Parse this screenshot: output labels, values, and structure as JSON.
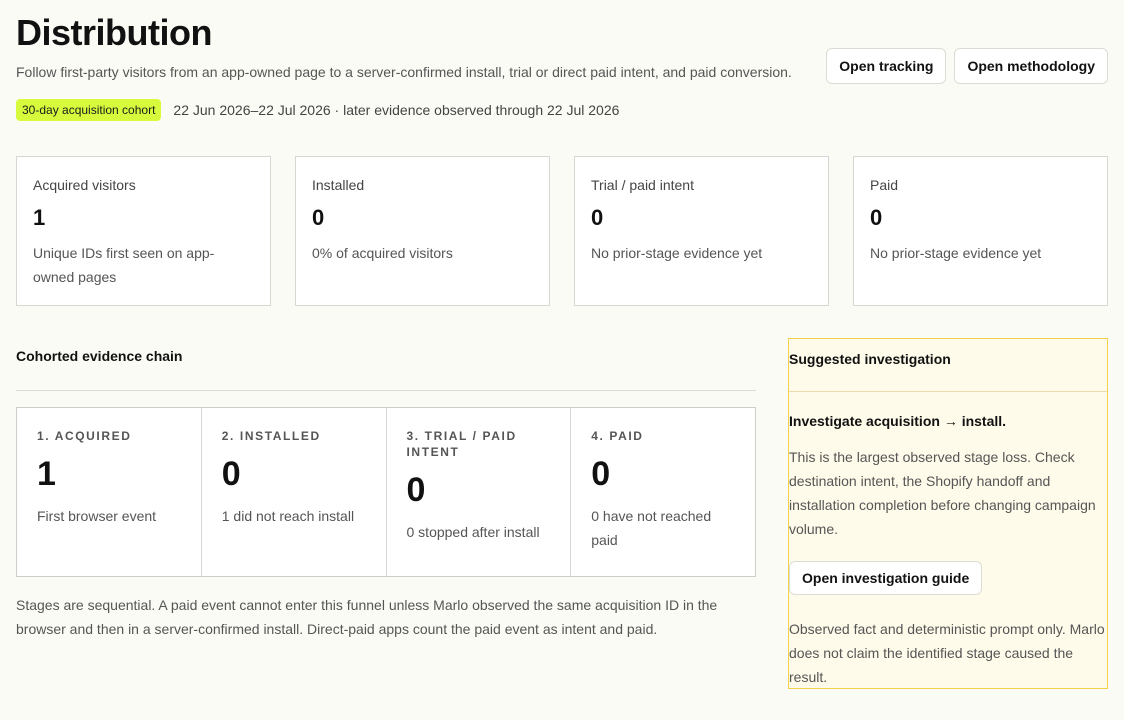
{
  "header": {
    "title": "Distribution",
    "subtitle": "Follow first-party visitors from an app-owned page to a server-confirmed install, trial or direct paid intent, and paid conversion.",
    "actions": {
      "open_tracking": "Open tracking",
      "open_methodology": "Open methodology"
    },
    "cohort_badge": "30-day acquisition cohort",
    "cohort_range": "22 Jun 2026–22 Jul 2026 · later evidence observed through 22 Jul 2026"
  },
  "kpis": [
    {
      "label": "Acquired visitors",
      "value": "1",
      "note": "Unique IDs first seen on app-owned pages"
    },
    {
      "label": "Installed",
      "value": "0",
      "note": "0% of acquired visitors"
    },
    {
      "label": "Trial / paid intent",
      "value": "0",
      "note": "No prior-stage evidence yet"
    },
    {
      "label": "Paid",
      "value": "0",
      "note": "No prior-stage evidence yet"
    }
  ],
  "chain": {
    "title": "Cohorted evidence chain",
    "stages": [
      {
        "label": "1. ACQUIRED",
        "value": "1",
        "note": "First browser event"
      },
      {
        "label": "2. INSTALLED",
        "value": "0",
        "note": "1 did not reach install"
      },
      {
        "label": "3. TRIAL / PAID INTENT",
        "value": "0",
        "note": "0 stopped after install"
      },
      {
        "label": "4. PAID",
        "value": "0",
        "note": "0 have not reached paid"
      }
    ],
    "footnote": "Stages are sequential. A paid event cannot enter this funnel unless Marlo observed the same acquisition ID in the browser and then in a server-confirmed install. Direct-paid apps count the paid event as intent and paid."
  },
  "investigation": {
    "title": "Suggested investigation",
    "headline": "Investigate acquisition → install.",
    "body": "This is the largest observed stage loss. Check destination intent, the Shopify handoff and installation completion before changing campaign volume.",
    "button": "Open investigation guide",
    "footnote": "Observed fact and deterministic prompt only. Marlo does not claim the identified stage caused the result."
  },
  "colors": {
    "background": "#fbfbf5",
    "badge": "#d7fb3c",
    "investigation_bg": "#fffbea",
    "investigation_border": "#f1d24a"
  }
}
